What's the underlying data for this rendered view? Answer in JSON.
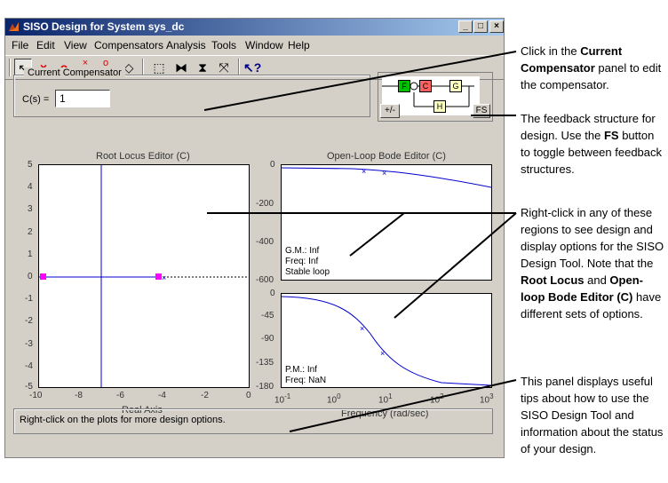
{
  "window": {
    "title": "SISO Design for System sys_dc",
    "controls": {
      "minimize": "_",
      "maximize": "□",
      "close": "×"
    }
  },
  "menu": [
    "File",
    "Edit",
    "View",
    "Compensators",
    "Analysis",
    "Tools",
    "Window",
    "Help"
  ],
  "toolbar": {
    "icons": [
      "pointer-icon",
      "add-pole-icon",
      "add-zero-icon",
      "add-complex-pole-icon",
      "add-complex-zero-icon",
      "eraser-icon",
      "zoom-box-icon",
      "zoom-x-icon",
      "zoom-y-icon",
      "fit-icon",
      "help-icon"
    ],
    "glyphs": {
      "pointer": "↖",
      "pole": "×",
      "zero": "o",
      "cpole": "×",
      "czero": "o",
      "eraser": "◇",
      "zoombox": "⬚",
      "zoomx": "⧓",
      "zoomy": "⧗",
      "fit": "⤧",
      "help": "↖?"
    }
  },
  "compensator": {
    "group_label": "Current Compensator",
    "label": "C(s) =",
    "value": "1"
  },
  "feedback": {
    "blocks": {
      "F": "F",
      "C": "C",
      "G": "G",
      "H": "H"
    },
    "sign_button": "+/-",
    "fs_button": "FS"
  },
  "root_locus": {
    "title": "Root Locus Editor (C)",
    "xlabel": "Real Axis",
    "yticks": [
      "5",
      "4",
      "3",
      "2",
      "1",
      "0",
      "-1",
      "-2",
      "-3",
      "-4",
      "-5"
    ],
    "xticks": [
      "-10",
      "-8",
      "-6",
      "-4",
      "-2",
      "0"
    ]
  },
  "bode": {
    "title": "Open-Loop Bode Editor (C)",
    "xlabel": "Frequency (rad/sec)",
    "mag_yticks": [
      "0",
      "-200",
      "-400",
      "-600"
    ],
    "phase_yticks": [
      "0",
      "-45",
      "-90",
      "-135",
      "-180"
    ],
    "xticks": [
      "10",
      "10",
      "10",
      "10",
      "10"
    ],
    "xexp": [
      "-1",
      "0",
      "1",
      "2",
      "3"
    ],
    "gm": "G.M.: Inf",
    "gm_freq": "Freq: Inf",
    "stable": "Stable loop",
    "pm": "P.M.: Inf",
    "pm_freq": "Freq: NaN"
  },
  "status": "Right-click on the plots for more design options.",
  "callouts": {
    "c1": [
      "Click in the ",
      "Current Compensator",
      " panel to edit the compensator."
    ],
    "c2": [
      "The feedback structure for design. Use the ",
      "FS",
      " button to toggle between feedback structures."
    ],
    "c3": [
      "Right-click in any of these regions to see design and display options for the SISO Design Tool. Note that the ",
      "Root Locus",
      " and ",
      "Open-loop Bode Editor (C)",
      " have different sets of options."
    ],
    "c4": [
      "This panel displays useful tips about how to use the SISO Design Tool and information about the status of your design."
    ]
  },
  "colors": {
    "titlebar": "#0a246a",
    "plot_line": "#0000cc",
    "pole_marker": "#ff00ff",
    "window_bg": "#d4d0c8"
  }
}
